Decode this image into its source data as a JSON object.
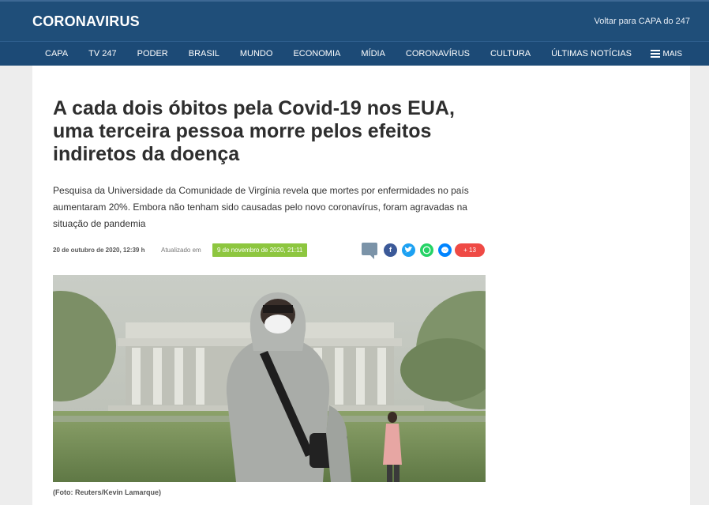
{
  "header": {
    "section_title": "CORONAVIRUS",
    "back_link": "Voltar para CAPA do 247"
  },
  "nav": {
    "items": [
      "CAPA",
      "TV 247",
      "PODER",
      "BRASIL",
      "MUNDO",
      "ECONOMIA",
      "MÍDIA",
      "CORONAVÍRUS",
      "CULTURA",
      "ÚLTIMAS NOTÍCIAS"
    ],
    "more_label": "MAIS"
  },
  "article": {
    "headline": "A cada dois óbitos pela Covid-19 nos EUA, uma terceira pessoa morre pelos efeitos indiretos da doença",
    "lead": "Pesquisa da Universidade da Comunidade de Virgínia revela que mortes por enfermidades no país aumentaram 20%. Embora não tenham sido causadas pelo novo coronavírus, foram agravadas na situação de pandemia",
    "published": "20 de outubro de 2020, 12:39 h",
    "updated_label": "Atualizado em",
    "updated": "9 de novembro de 2020, 21:11",
    "share_count": "13",
    "photo_caption": "(Foto: Reuters/Kevin Lamarque)"
  },
  "colors": {
    "header_bg": "#1f4e79",
    "updated_badge": "#8dc63f",
    "share_more": "#ef4a45"
  },
  "icons": {
    "comments": "comment-icon",
    "facebook": "facebook-icon",
    "twitter": "twitter-icon",
    "whatsapp": "whatsapp-icon",
    "messenger": "messenger-icon",
    "menu": "menu-icon"
  }
}
